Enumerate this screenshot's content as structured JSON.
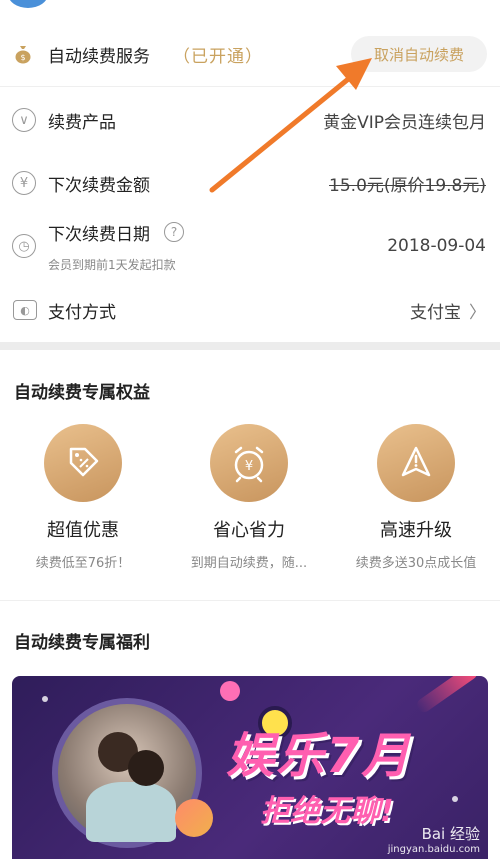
{
  "service": {
    "title": "自动续费服务",
    "status": "（已开通）",
    "cancel_label": "取消自动续费"
  },
  "details": {
    "product_label": "续费产品",
    "product_value": "黄金VIP会员连续包月",
    "amount_label": "下次续费金额",
    "amount_value": "15.0元(原价19.8元)",
    "date_label": "下次续费日期",
    "date_value": "2018-09-04",
    "date_note": "会员到期前1天发起扣款",
    "pay_label": "支付方式",
    "pay_value": "支付宝",
    "currency_symbol": "¥",
    "help_symbol": "?"
  },
  "benefits": {
    "title": "自动续费专属权益",
    "items": [
      {
        "name": "超值优惠",
        "desc": "续费低至76折！",
        "icon": "discount-tag-icon"
      },
      {
        "name": "省心省力",
        "desc": "到期自动续费，随...",
        "icon": "alarm-clock-icon"
      },
      {
        "name": "高速升级",
        "desc": "续费多送30点成长值",
        "icon": "rocket-icon"
      }
    ]
  },
  "welfare": {
    "title": "自动续费专属福利",
    "banner_headline": "娱乐7月",
    "banner_sub": "拒绝无聊!"
  },
  "watermark": {
    "brand": "Bai 经验",
    "url": "jingyan.baidu.com"
  },
  "colors": {
    "accent_gold": "#c9a25f",
    "annotation_arrow": "#f07a2a",
    "banner_bg": "#3a2266"
  }
}
